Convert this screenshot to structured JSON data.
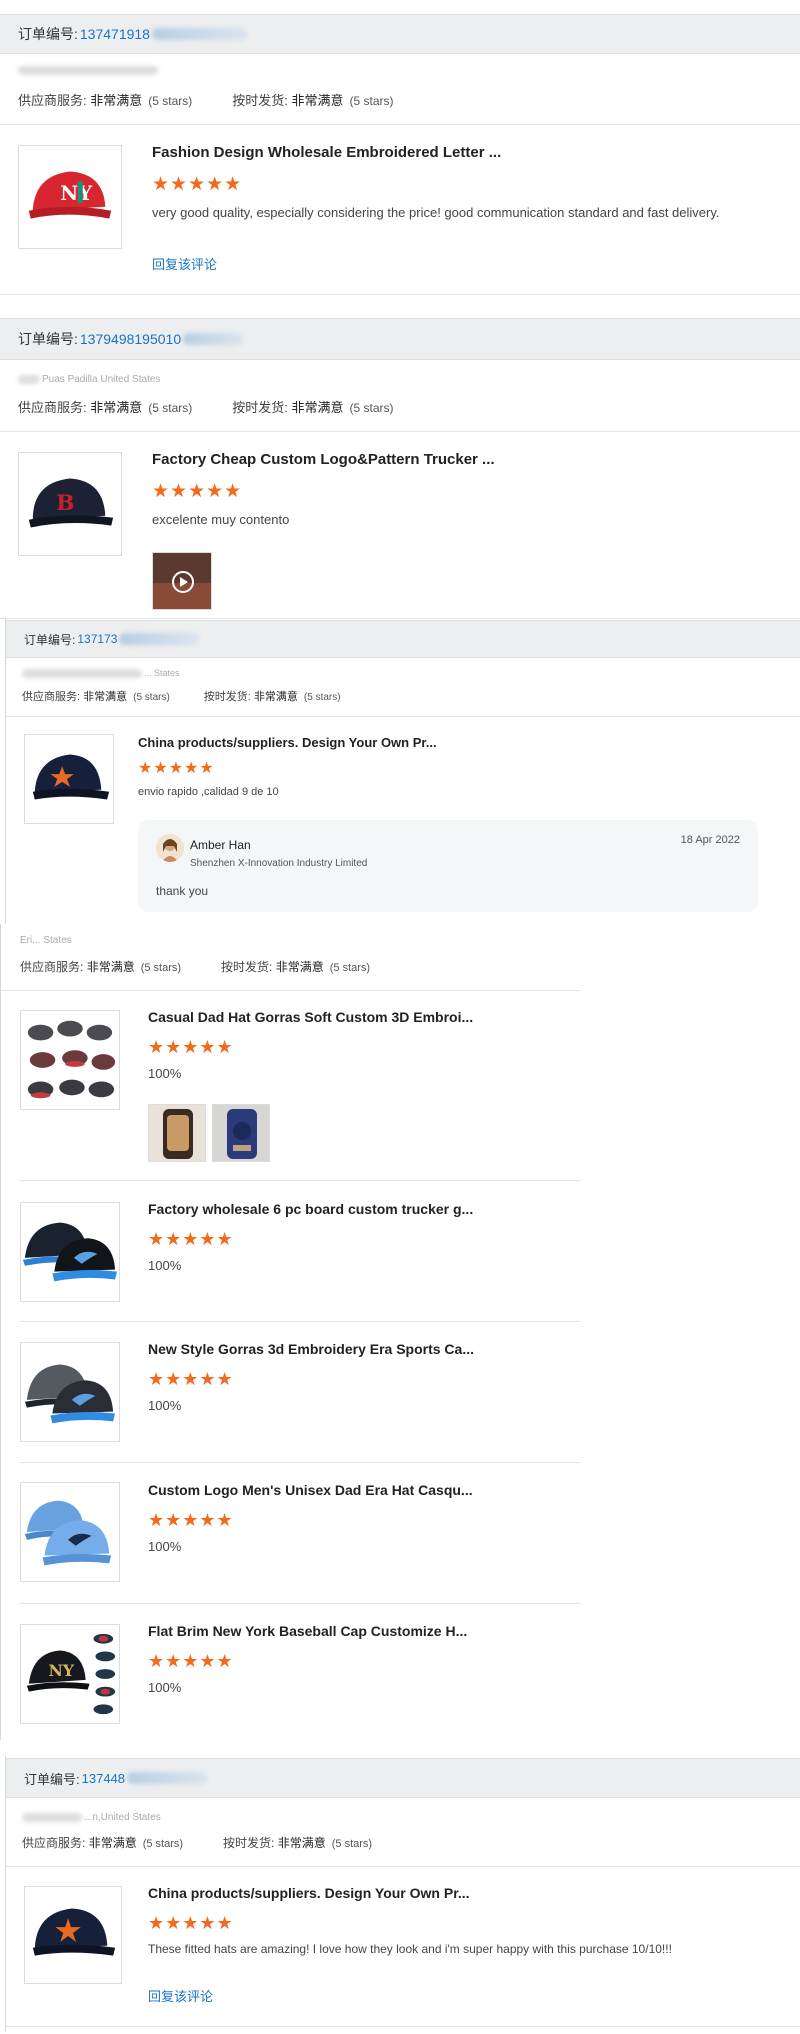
{
  "labels": {
    "order_no": "订单编号:",
    "supplier_service": "供应商服务:",
    "on_time": "按时发货:",
    "very_satisfied": "非常满意",
    "stars_text": "(5 stars)",
    "reply": "回复该评论",
    "stars": "★★★★★"
  },
  "orders": [
    {
      "number": "137471918",
      "buyer": "",
      "products": [
        {
          "title": "Fashion Design Wholesale Embroidered Letter ...",
          "rating": 5,
          "comment": "very good quality, especially considering the price! good communication standard and fast delivery."
        }
      ]
    },
    {
      "number": "1379498195010",
      "buyer": "Puas Padilla United States",
      "products": [
        {
          "title": "Factory Cheap Custom Logo&Pattern Trucker ...",
          "rating": 5,
          "comment": "excelente  muy contento"
        }
      ]
    },
    {
      "number": "137173",
      "buyer": "... States",
      "products": [
        {
          "title": "China products/suppliers. Design Your Own Pr...",
          "rating": 5,
          "comment": "envio rapido ,calidad 9 de 10"
        }
      ],
      "reply": {
        "name": "Amber Han",
        "company": "Shenzhen X-Innovation Industry Limited",
        "date": "18 Apr 2022",
        "text": "thank you"
      }
    },
    {
      "number": "",
      "buyer": "Eri... States",
      "products": [
        {
          "title": "Casual Dad Hat Gorras Soft Custom 3D Embroi...",
          "rating": 5,
          "comment": "100%"
        },
        {
          "title": "Factory wholesale 6 pc board custom trucker g...",
          "rating": 5,
          "comment": "100%"
        },
        {
          "title": "New Style Gorras 3d Embroidery Era Sports Ca...",
          "rating": 5,
          "comment": "100%"
        },
        {
          "title": "Custom Logo Men's Unisex Dad Era Hat Casqu...",
          "rating": 5,
          "comment": "100%"
        },
        {
          "title": "Flat Brim New York Baseball Cap Customize H...",
          "rating": 5,
          "comment": "100%"
        }
      ]
    },
    {
      "number": "137448",
      "buyer": "...n,United States",
      "products": [
        {
          "title": "China products/suppliers. Design Your Own Pr...",
          "rating": 5,
          "comment": "These fitted hats are amazing! I love how they look and i'm super happy with this purchase 10/10!!!"
        }
      ]
    }
  ],
  "colors": {
    "accent": "#1a73c8",
    "star": "#f26b1d",
    "order_bar": "#eceeef"
  }
}
